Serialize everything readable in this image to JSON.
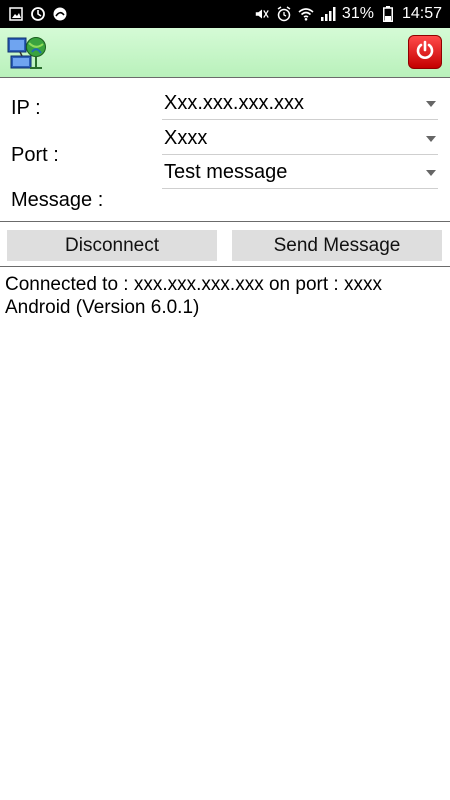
{
  "status_bar": {
    "battery_percent": "31%",
    "time": "14:57"
  },
  "form": {
    "ip_label": "IP :",
    "ip_value": "Xxx.xxx.xxx.xxx",
    "port_label": "Port :",
    "port_value": "Xxxx",
    "message_label": "Message :",
    "message_value": "Test message"
  },
  "buttons": {
    "disconnect_label": "Disconnect",
    "send_label": "Send Message"
  },
  "log": {
    "lines": [
      "Connected to : xxx.xxx.xxx.xxx on port : xxxx",
      "Android (Version 6.0.1)"
    ]
  },
  "colors": {
    "appbar": "#c8f7c9",
    "power_button": "#e00000",
    "button_bg": "#dedede"
  }
}
